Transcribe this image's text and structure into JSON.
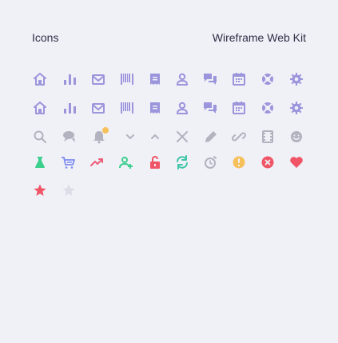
{
  "header": {
    "title": "Icons",
    "kit": "Wireframe Web Kit"
  },
  "colors": {
    "accent": "#9b95dc",
    "muted": "#b3b3c0",
    "green": "#3ccf8e",
    "blue": "#7d8cf0",
    "pink": "#ee5d78",
    "red": "#ef5566",
    "teal": "#3cc5a6",
    "warning": "#f6c15a",
    "faded": "#dddde7"
  },
  "icons": [
    [
      "home-icon",
      "bar-chart-icon",
      "mail-icon",
      "barcode-icon",
      "receipt-icon",
      "user-icon",
      "chat-icon",
      "calendar-icon",
      "lifebuoy-icon",
      "gear-icon"
    ],
    [
      "home-icon",
      "bar-chart-icon",
      "mail-icon",
      "barcode-icon",
      "receipt-icon",
      "user-icon",
      "chat-icon",
      "calendar-icon",
      "lifebuoy-icon",
      "gear-icon"
    ],
    [
      "search-icon",
      "comment-icon",
      "bell-icon",
      "chevron-down-icon",
      "chevron-up-icon",
      "close-icon",
      "pencil-icon",
      "link-icon",
      "film-icon",
      "smile-icon"
    ],
    [
      "flask-icon",
      "cart-icon",
      "trending-up-icon",
      "add-user-icon",
      "unlock-icon",
      "refresh-icon",
      "alarm-icon",
      "warning-icon",
      "error-icon",
      "heart-icon"
    ],
    [
      "star-filled-icon",
      "star-empty-icon"
    ]
  ]
}
